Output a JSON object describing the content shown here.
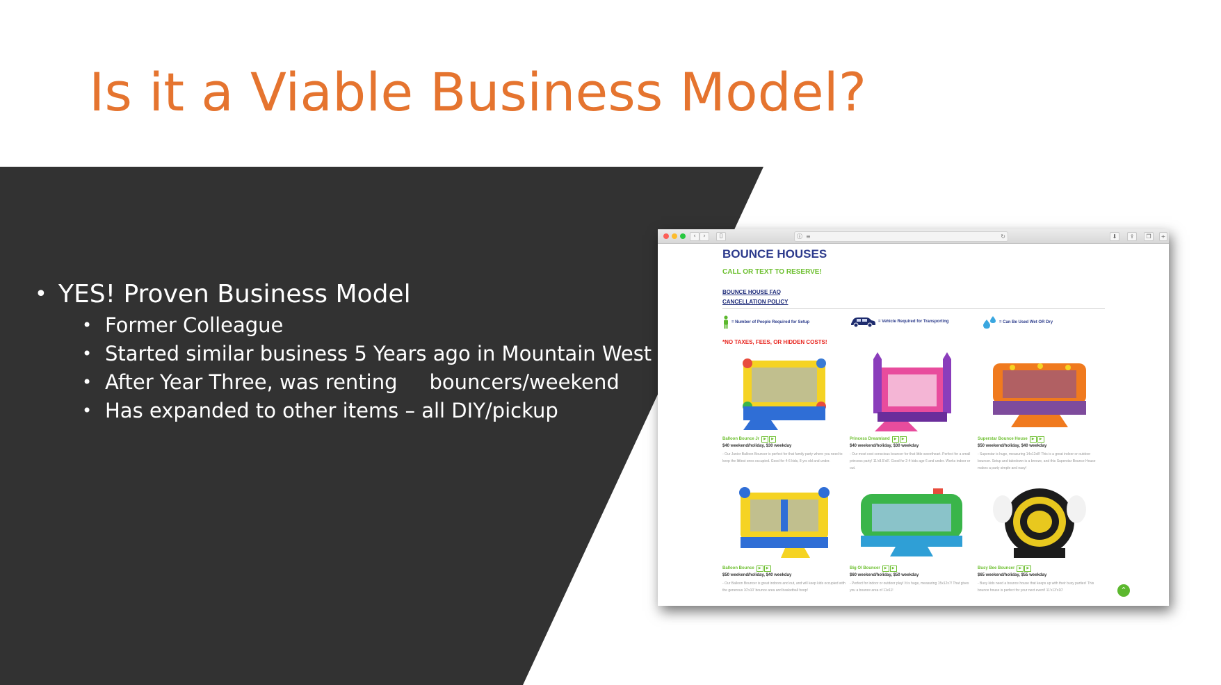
{
  "slide": {
    "title": "Is it a Viable Business Model?",
    "bullet_main": "YES!  Proven Business Model",
    "sub_bullets": [
      "Former Colleague",
      "Started similar business 5 Years ago in Mountain West",
      "Has expanded to other items – all DIY/pickup"
    ],
    "renting_before": "After Year Three, was renting",
    "renting_after": "bouncers/weekend"
  },
  "colors": {
    "title": "#e5742f",
    "panel": "#323232",
    "site_title": "#2c3a8c",
    "site_green": "#6cbf2e",
    "site_red": "#e8261f"
  },
  "browser": {
    "window_controls": [
      "close",
      "minimize",
      "zoom"
    ],
    "toolbar_icons": [
      "back-icon",
      "forward-icon",
      "sidebar-icon",
      "info-icon",
      "reader-icon",
      "reload-icon",
      "download-icon",
      "share-icon",
      "tabs-icon",
      "new-tab-icon"
    ],
    "page": {
      "title": "BOUNCE HOUSES",
      "call": "CALL OR TEXT TO RESERVE!",
      "faq_link": "BOUNCE HOUSE FAQ",
      "cancel_link": "CANCELLATION POLICY",
      "legend": {
        "people": "= Number of People Required for Setup",
        "vehicle": "= Vehicle Required for Transporting",
        "wetdry": "= Can Be Used Wet OR Dry"
      },
      "no_taxes": "*NO TAXES, FEES, OR HIDDEN COSTS!",
      "products": [
        {
          "name": "Balloon Bounce Jr",
          "price": "$40 weekend/holiday, $30 weekday",
          "desc": "- Our Junior Balloon Bouncer is perfect for that family party where you need to keep the littlest ones occupied. Good for 4-6 kids, 8 yrs old and under."
        },
        {
          "name": "Princess Dreamland",
          "price": "$40 weekend/holiday, $30 weekday",
          "desc": "- Our most cost conscious bouncer for that little sweetheart. Perfect for a small princess party! 11'x8.5'x8'. Good for 2-4 kids age 6 and under. Works indoor or out."
        },
        {
          "name": "Superstar Bounce House",
          "price": "$50 weekend/holiday, $40 weekday",
          "desc": "- Superstar is huge, measuring 14x12x8! This is a great indoor or outdoor bouncer. Setup and takedown is a breeze, and this Superstar Bounce House makes a party simple and easy!"
        },
        {
          "name": "Balloon Bounce",
          "price": "$50 weekend/holiday, $40 weekday",
          "desc": "- Our Balloon Bouncer is great indoors and out, and will keep kids occupied with the generous 10'x10' bounce area and basketball hoop!"
        },
        {
          "name": "Big Ol Bouncer",
          "price": "$60 weekend/holiday, $50 weekday",
          "desc": "- Perfect for indoor or outdoor play! It is huge, measuring 15x12x7! That gives you a bounce area of 11x11!"
        },
        {
          "name": "Busy Bee Bouncer",
          "price": "$65 weekend/holiday, $55 weekday",
          "desc": "- Busy kids need a bounce house that keeps up with their busy parties! This bounce house is perfect for your next event! 11'x13'x10'"
        }
      ]
    }
  }
}
